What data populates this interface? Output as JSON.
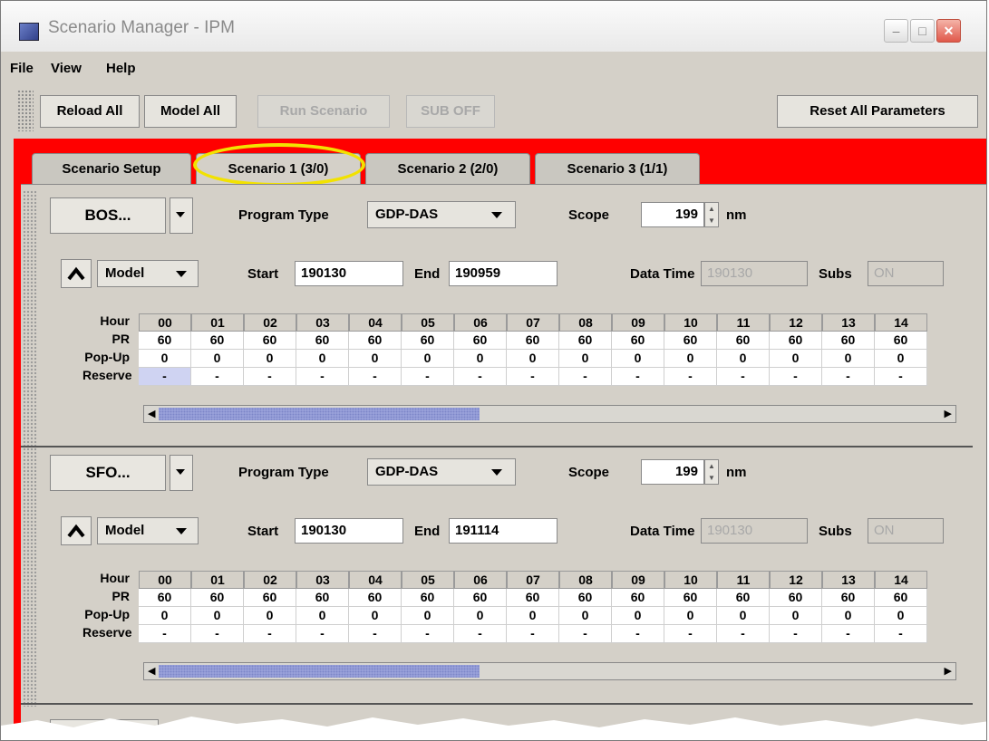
{
  "window": {
    "title": "Scenario Manager - IPM"
  },
  "menu": [
    {
      "label": "File"
    },
    {
      "label": "View"
    },
    {
      "label": "Help"
    }
  ],
  "toolbar": {
    "reload_all": "Reload All",
    "model_all": "Model All",
    "run_scenario": "Run Scenario",
    "sub_off": "SUB OFF",
    "reset_all": "Reset All Parameters"
  },
  "tabs": [
    {
      "label": "Scenario Setup"
    },
    {
      "label": "Scenario 1 (3/0)"
    },
    {
      "label": "Scenario 2 (2/0)"
    },
    {
      "label": "Scenario 3 (1/1)"
    }
  ],
  "panels": [
    {
      "airport": "BOS...",
      "program_type_label": "Program Type",
      "program_type": "GDP-DAS",
      "scope_label": "Scope",
      "scope": "199",
      "scope_unit": "nm",
      "mode": "Model",
      "start_label": "Start",
      "start": "190130",
      "end_label": "End",
      "end": "190959",
      "data_time_label": "Data Time",
      "data_time": "190130",
      "subs_label": "Subs",
      "subs": "ON"
    },
    {
      "airport": "SFO...",
      "program_type_label": "Program Type",
      "program_type": "GDP-DAS",
      "scope_label": "Scope",
      "scope": "199",
      "scope_unit": "nm",
      "mode": "Model",
      "start_label": "Start",
      "start": "190130",
      "end_label": "End",
      "end": "191114",
      "data_time_label": "Data Time",
      "data_time": "190130",
      "subs_label": "Subs",
      "subs": "ON"
    }
  ],
  "grid": {
    "row_labels": [
      "Hour",
      "PR",
      "Pop-Up",
      "Reserve"
    ],
    "hours": [
      "00",
      "01",
      "02",
      "03",
      "04",
      "05",
      "06",
      "07",
      "08",
      "09",
      "10",
      "11",
      "12",
      "13",
      "14"
    ],
    "pr": [
      "60",
      "60",
      "60",
      "60",
      "60",
      "60",
      "60",
      "60",
      "60",
      "60",
      "60",
      "60",
      "60",
      "60",
      "60"
    ],
    "popup": [
      "0",
      "0",
      "0",
      "0",
      "0",
      "0",
      "0",
      "0",
      "0",
      "0",
      "0",
      "0",
      "0",
      "0",
      "0"
    ],
    "reserve": [
      "-",
      "-",
      "-",
      "-",
      "-",
      "-",
      "-",
      "-",
      "-",
      "-",
      "-",
      "-",
      "-",
      "-",
      "-"
    ]
  }
}
